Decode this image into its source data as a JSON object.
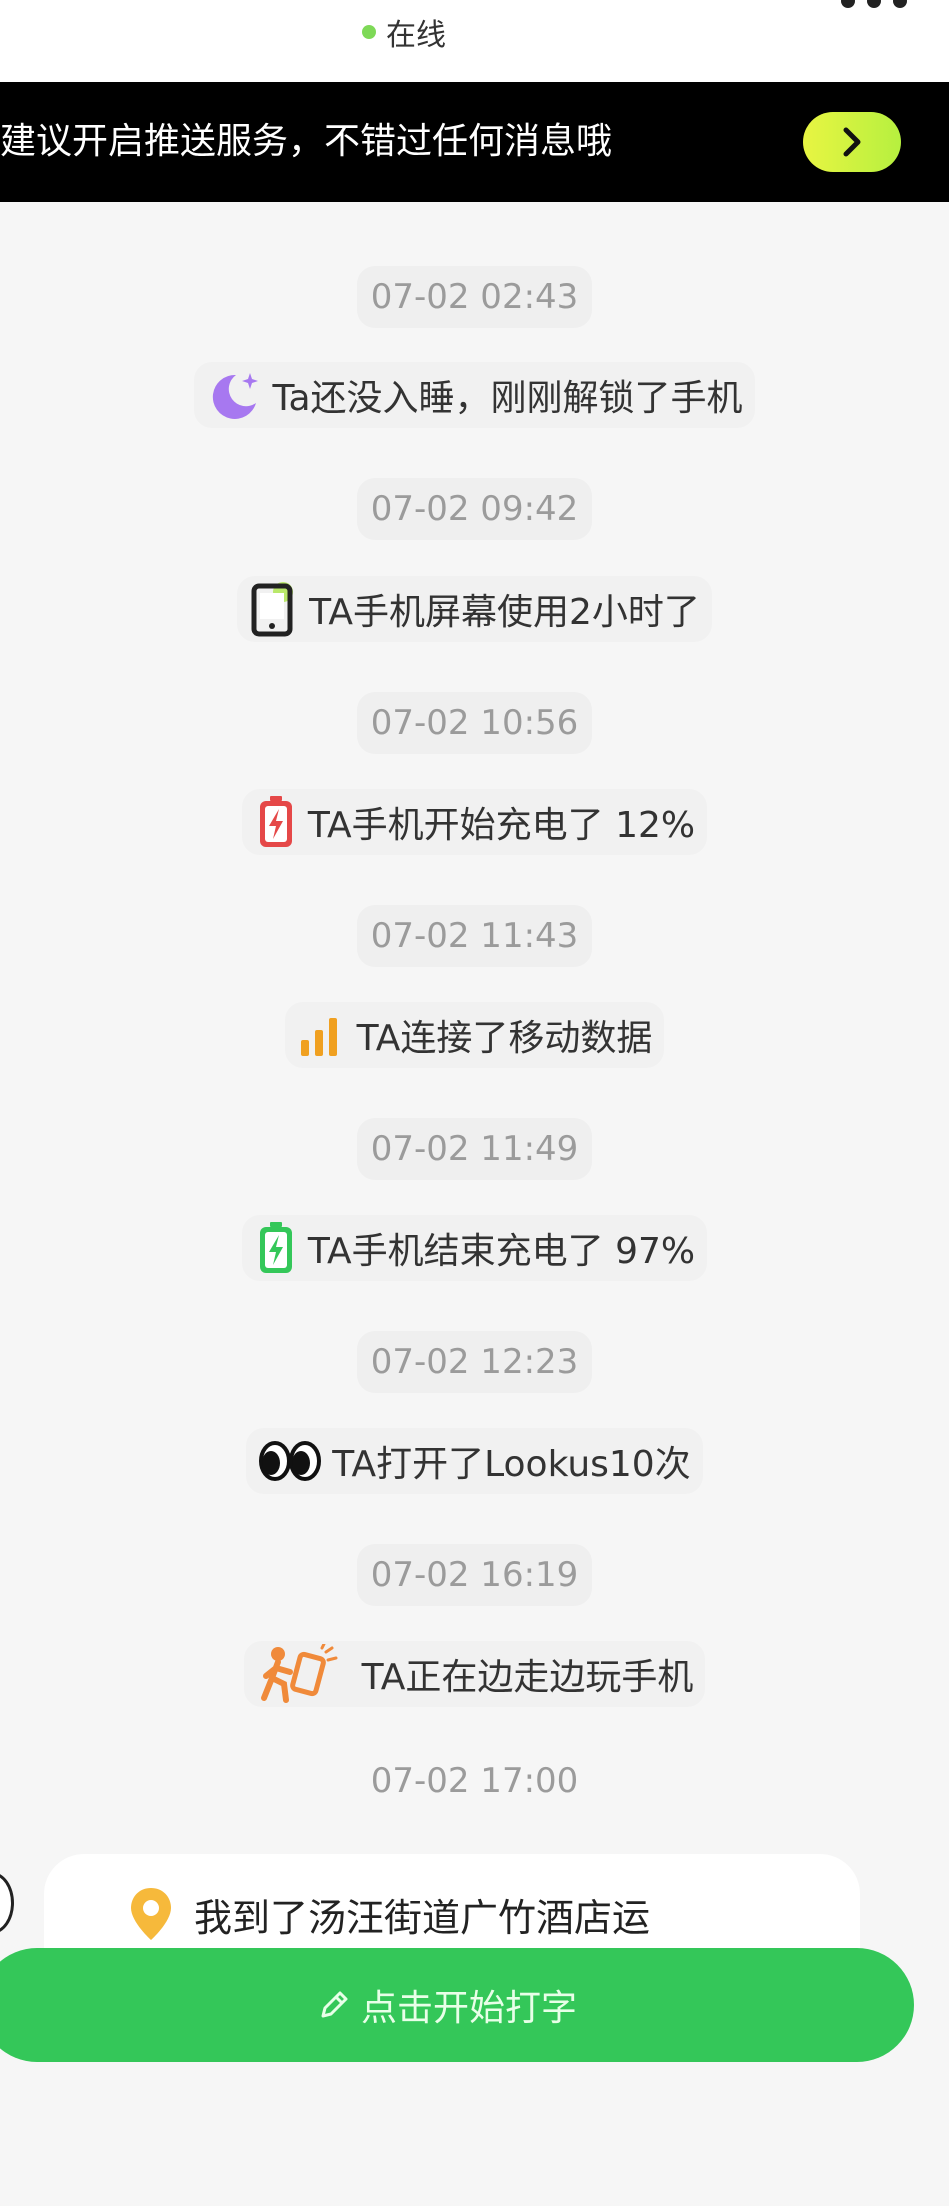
{
  "header": {
    "status_text": "在线",
    "status_color": "#7ed957",
    "more_icon": "more-dots-icon"
  },
  "banner": {
    "text": "建议开启推送服务，不错过任何消息哦",
    "button_icon": "chevron-right-icon"
  },
  "events": [
    {
      "time": "07-02 02:43",
      "icon": "moon-icon",
      "text": "Ta还没入睡，刚刚解锁了手机"
    },
    {
      "time": "07-02 09:42",
      "icon": "phone-screen-icon",
      "text": "TA手机屏幕使用2小时了"
    },
    {
      "time": "07-02 10:56",
      "icon": "battery-charging-red-icon",
      "text": "TA手机开始充电了 12%"
    },
    {
      "time": "07-02 11:43",
      "icon": "signal-bars-icon",
      "text": "TA连接了移动数据"
    },
    {
      "time": "07-02 11:49",
      "icon": "battery-charging-green-icon",
      "text": "TA手机结束充电了 97%"
    },
    {
      "time": "07-02 12:23",
      "icon": "eyes-icon",
      "text": "TA打开了Lookus10次"
    },
    {
      "time": "07-02 16:19",
      "icon": "walking-phone-icon",
      "text": "TA正在边走边玩手机"
    },
    {
      "time": "07-02 17:00"
    }
  ],
  "location_message": {
    "icon": "location-pin-icon",
    "text": "我到了汤汪街道广竹酒店运"
  },
  "composer": {
    "icon": "pencil-icon",
    "label": "点击开始打字",
    "color": "#34c759"
  }
}
